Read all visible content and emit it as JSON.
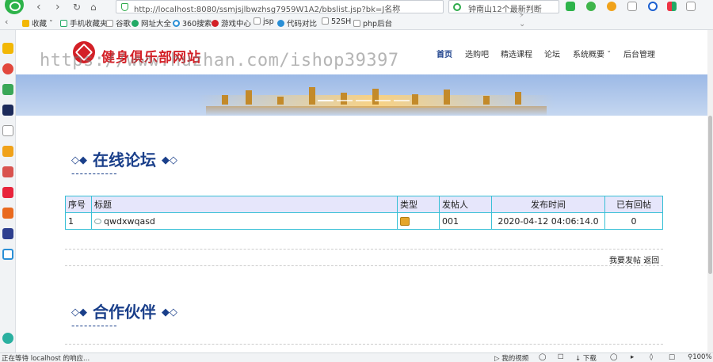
{
  "browser": {
    "url": "http://localhost:8080/ssmjsjlbwzhsg7959W1A2/bbslist.jsp?bk=J名称",
    "search_text": "钟南山12个最新判断",
    "bookmarks": [
      "收藏",
      "手机收藏夹",
      "谷歌",
      "网址大全",
      "360搜索",
      "游戏中心",
      "jsp",
      "代码对比",
      "52SH",
      "php后台"
    ],
    "status_text": "正在等待 localhost 的响应...",
    "status_items": [
      "我的视频",
      "下载",
      "100%"
    ],
    "colors": {
      "accent_green": "#2db34a",
      "toolbar_bg": "#f3f5f7"
    }
  },
  "site": {
    "brand": "健身俱乐部网站",
    "watermark": "https://www.huzhan.com/ishop39397",
    "nav": [
      "首页",
      "选购吧",
      "精选课程",
      "论坛",
      "系统概要",
      "后台管理"
    ],
    "active_nav": "首页",
    "brand_color": "#d32027",
    "title_color": "#1a3f8a"
  },
  "forum": {
    "title": "在线论坛",
    "underline": "-----------",
    "columns": [
      "序号",
      "标题",
      "类型",
      "发帖人",
      "发布时间",
      "已有回帖"
    ],
    "rows": [
      {
        "no": "1",
        "title": "qwdxwqasd",
        "author": "001",
        "time": "2020-04-12 04:06:14.0",
        "replies": "0"
      }
    ],
    "post_link": "我要发帖",
    "back_link": "返回"
  },
  "partners": {
    "title": "合作伙伴",
    "underline": "-----------"
  }
}
